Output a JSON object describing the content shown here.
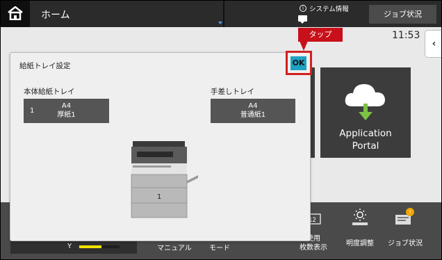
{
  "header": {
    "home_title": "ホーム",
    "system_info": "システム情報",
    "job_status_button": "ジョブ状況"
  },
  "status": {
    "clock": "11:53"
  },
  "tiles": {
    "application_portal": [
      "Application",
      "Portal"
    ]
  },
  "callout": {
    "label": "タップ"
  },
  "dialog": {
    "title": "給紙トレイ設定",
    "ok_label": "OK",
    "main_tray": {
      "label": "本体給紙トレイ",
      "number": "1",
      "size": "A4",
      "paper_type": "厚紙1"
    },
    "bypass_tray": {
      "label": "手差しトレイ",
      "size": "A4",
      "paper_type": "普通紙1"
    },
    "printer_tray_number": "1"
  },
  "bottom_bar": {
    "toner_label": "Y",
    "toner_level": 0.55,
    "items": {
      "manual": "マニュアル",
      "mode": "モード",
      "count_line1": "使用",
      "count_line2": "枚数表示",
      "brightness": "明度調整",
      "job_status": "ジョブ状況"
    }
  },
  "colors": {
    "ok_button": "#1fa1c4",
    "callout": "#c8101a",
    "toner_yellow": "#f2e200",
    "tile": "#3c3c3c"
  },
  "icons": [
    "home-icon",
    "info-icon",
    "speech-icon",
    "chevron-left-icon",
    "cloud-download-icon",
    "counter-icon",
    "brightness-icon",
    "job-status-icon"
  ]
}
